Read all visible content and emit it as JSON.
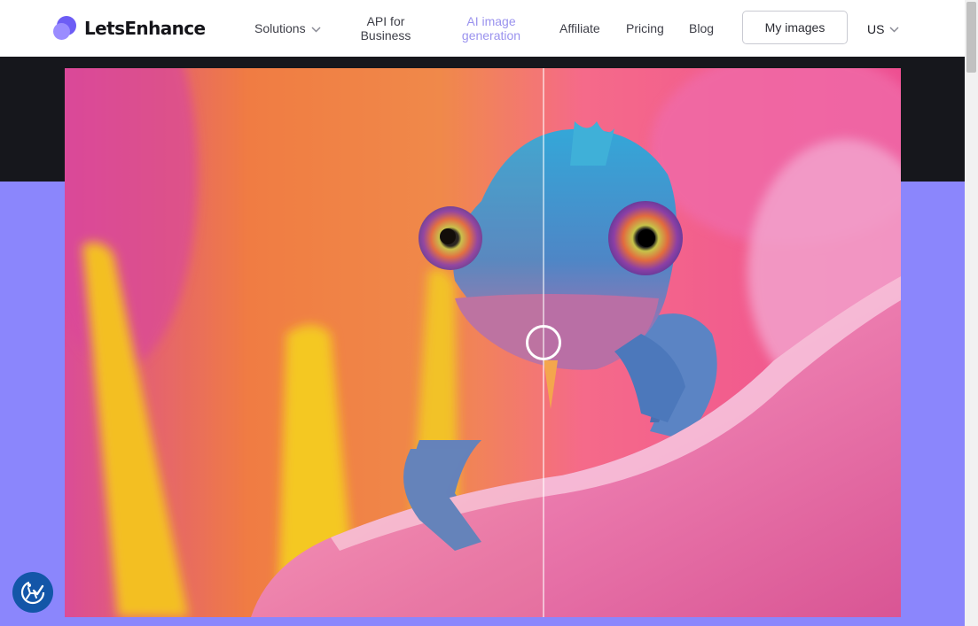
{
  "brand": {
    "name": "LetsEnhance",
    "logo_icon": "letsenhance-logo-icon"
  },
  "nav": {
    "solutions": {
      "label": "Solutions",
      "icon": "chevron-down-icon"
    },
    "api": {
      "line1": "API for",
      "line2": "Business"
    },
    "ai_image": {
      "line1": "AI image",
      "line2": "generation"
    },
    "affiliate": "Affiliate",
    "pricing": "Pricing",
    "blog": "Blog"
  },
  "actions": {
    "my_images": "My images",
    "locale": {
      "label": "US",
      "icon": "chevron-down-icon"
    }
  },
  "compare": {
    "left_state": "original-blurred",
    "right_state": "enhanced-sharp",
    "split_position_percent": 57
  },
  "accessibility": {
    "icon": "accessibility-icon"
  },
  "colors": {
    "brand_purple": "#6d5df5",
    "purple_band": "#8b86fc",
    "dark_band": "#16171c",
    "active_nav": "#9a92ee",
    "accessibility_blue": "#1356a8"
  }
}
